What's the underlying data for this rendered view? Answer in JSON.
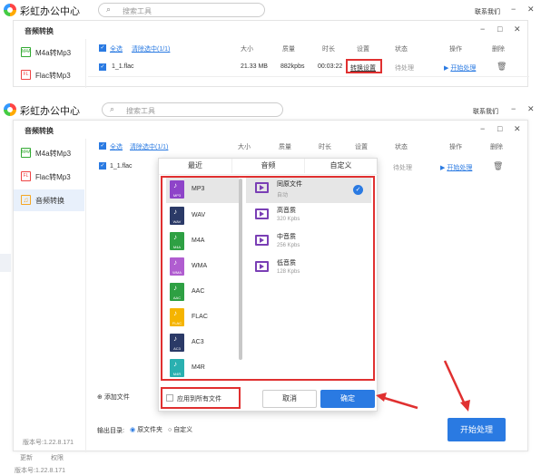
{
  "app": {
    "title": "彩虹办公中心",
    "search_placeholder": "搜索工具",
    "contact": "联系我们",
    "version": "版本号:1.22.8.171"
  },
  "window_controls": {
    "minimize": "−",
    "maximize": "□",
    "close": "✕"
  },
  "window_title": "音频转换",
  "sidebar": {
    "items": [
      {
        "label": "M4a转Mp3",
        "icon": "M4A"
      },
      {
        "label": "Flac转Mp3",
        "icon": "FLAC"
      },
      {
        "label": "音频转换",
        "icon": "♫"
      }
    ]
  },
  "table": {
    "select_all": "全选",
    "clear_list": "清除选中(1/1)",
    "columns": [
      "大小",
      "质量",
      "时长",
      "设置",
      "状态",
      "操作",
      "删除"
    ],
    "rows": [
      {
        "name": "1_1.flac",
        "size": "21.33 MB",
        "quality": "882kpbs",
        "duration": "00:03:22",
        "setting": "转换设置",
        "status": "待处理",
        "action": "开始处理"
      }
    ]
  },
  "popup": {
    "tabs": [
      "最近",
      "音频",
      "自定义"
    ],
    "formats": [
      {
        "name": "MP3",
        "color": "#8e44c9"
      },
      {
        "name": "WAV",
        "color": "#2b3a67"
      },
      {
        "name": "M4A",
        "color": "#2ea043"
      },
      {
        "name": "WMA",
        "color": "#b05dd0"
      },
      {
        "name": "AAC",
        "color": "#2ea043"
      },
      {
        "name": "FLAC",
        "color": "#f5b400"
      },
      {
        "name": "AC3",
        "color": "#2b3a67"
      },
      {
        "name": "M4R",
        "color": "#2ab0b0"
      }
    ],
    "qualities": [
      {
        "name": "同原文件",
        "sub": "自动"
      },
      {
        "name": "高音质",
        "sub": "320 Kpbs"
      },
      {
        "name": "中音质",
        "sub": "256 Kpbs"
      },
      {
        "name": "低音质",
        "sub": "128 Kpbs"
      }
    ],
    "apply_all": "应用到所有文件",
    "cancel": "取消",
    "confirm": "确定"
  },
  "bottom": {
    "add_file": "添加文件",
    "output_label": "输出目录:",
    "opt_source": "原文件夹",
    "opt_custom": "自定义",
    "start": "开始处理"
  },
  "footer": {
    "left1": "更新",
    "left2": "权限"
  },
  "colors": {
    "accent": "#2a7ae2",
    "highlight": "#e03030"
  }
}
